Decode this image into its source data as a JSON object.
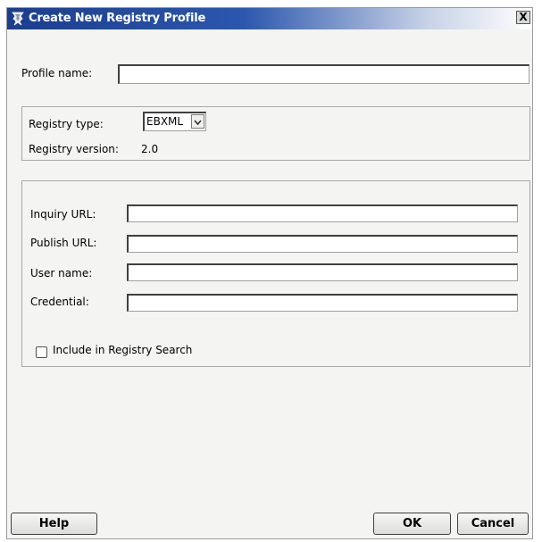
{
  "window": {
    "title": "Create New Registry Profile",
    "close_glyph": "X"
  },
  "profile": {
    "name_label": "Profile name:",
    "name_value": ""
  },
  "registry": {
    "type_label": "Registry type:",
    "type_value": "EBXML",
    "version_label": "Registry version:",
    "version_value": "2.0"
  },
  "connection": {
    "inquiry_label": "Inquiry URL:",
    "inquiry_value": "",
    "publish_label": "Publish URL:",
    "publish_value": "",
    "user_label": "User name:",
    "user_value": "",
    "credential_label": "Credential:",
    "credential_value": "",
    "include_label": "Include in Registry Search",
    "include_checked": false
  },
  "buttons": {
    "help": "Help",
    "ok": "OK",
    "cancel": "Cancel"
  },
  "icons": {
    "title": "app-logo-icon",
    "dropdown": "chevron-down-icon"
  },
  "colors": {
    "titlebar_start": "#1b3e8e",
    "titlebar_end": "#ffffff",
    "dialog_background": "#f4f4f2"
  }
}
